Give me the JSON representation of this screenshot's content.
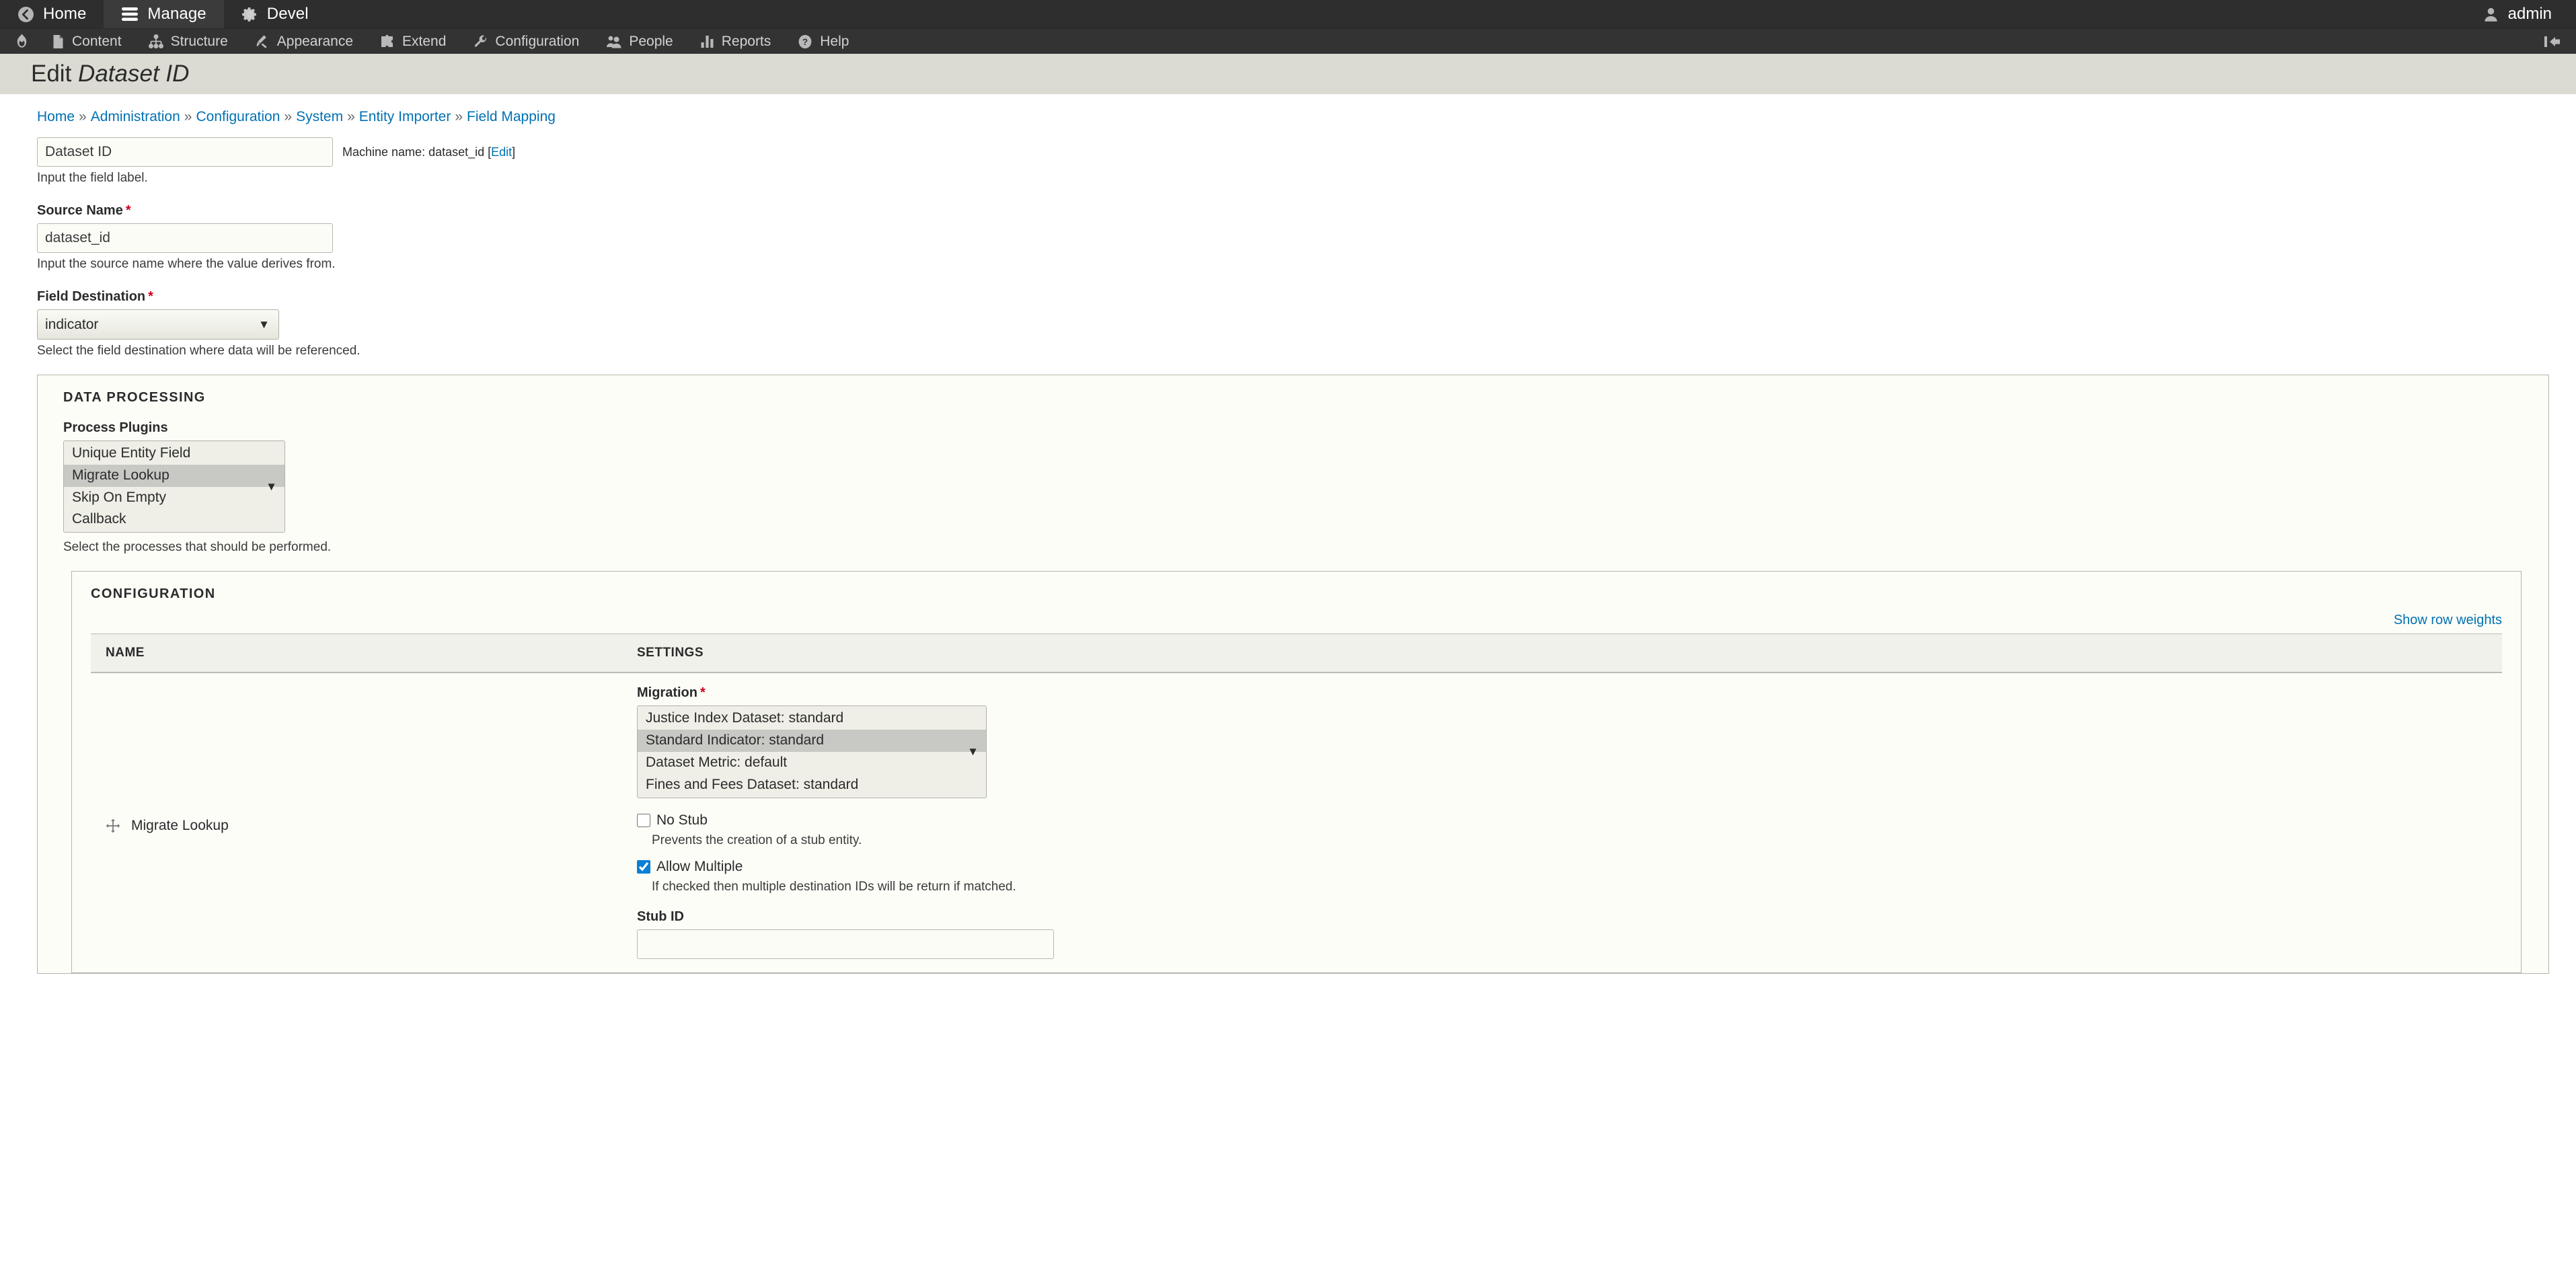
{
  "toolbar": {
    "items": [
      {
        "label": "Home",
        "icon": "home-back-icon",
        "active": false
      },
      {
        "label": "Manage",
        "icon": "hamburger-icon",
        "active": true
      },
      {
        "label": "Devel",
        "icon": "gear-icon",
        "active": false
      }
    ],
    "account": {
      "label": "admin",
      "icon": "user-avatar-icon"
    }
  },
  "admin_menu": {
    "home_icon": "drupal-drop-icon",
    "items": [
      {
        "label": "Content",
        "icon": "document-icon"
      },
      {
        "label": "Structure",
        "icon": "sitemap-icon"
      },
      {
        "label": "Appearance",
        "icon": "paintbrush-icon"
      },
      {
        "label": "Extend",
        "icon": "puzzle-piece-icon"
      },
      {
        "label": "Configuration",
        "icon": "wrench-icon"
      },
      {
        "label": "People",
        "icon": "people-icon"
      },
      {
        "label": "Reports",
        "icon": "bar-chart-icon"
      },
      {
        "label": "Help",
        "icon": "question-mark-icon"
      }
    ],
    "collapse_icon": "collapse-sidebar-icon"
  },
  "page": {
    "title_prefix": "Edit",
    "title_emphasis": "Dataset ID"
  },
  "breadcrumb": {
    "separator": "»",
    "items": [
      "Home",
      "Administration",
      "Configuration",
      "System",
      "Entity Importer",
      "Field Mapping"
    ]
  },
  "form": {
    "label_field": {
      "value": "Dataset ID",
      "machine_name_prefix": "Machine name: dataset_id [",
      "machine_name_edit": "Edit",
      "machine_name_suffix": "]",
      "description": "Input the field label."
    },
    "source_name": {
      "label": "Source Name",
      "required_mark": "*",
      "value": "dataset_id",
      "description": "Input the source name where the value derives from."
    },
    "field_destination": {
      "label": "Field Destination",
      "required_mark": "*",
      "selected": "indicator",
      "options": [
        "indicator"
      ],
      "description": "Select the field destination where data will be referenced."
    }
  },
  "data_processing": {
    "title": "Data Processing",
    "process_plugins": {
      "label": "Process Plugins",
      "options": [
        {
          "label": "Unique Entity Field",
          "selected": false
        },
        {
          "label": "Migrate Lookup",
          "selected": true
        },
        {
          "label": "Skip On Empty",
          "selected": false
        },
        {
          "label": "Callback",
          "selected": false
        }
      ],
      "description": "Select the processes that should be performed."
    },
    "configuration": {
      "title": "Configuration",
      "show_row_weights": "Show row weights",
      "columns": [
        "Name",
        "Settings"
      ],
      "rows": [
        {
          "name": "Migrate Lookup",
          "drag_icon": "drag-handle-icon",
          "settings": {
            "migration": {
              "label": "Migration",
              "required_mark": "*",
              "options": [
                {
                  "label": "Justice Index Dataset: standard",
                  "selected": false
                },
                {
                  "label": "Standard Indicator: standard",
                  "selected": true
                },
                {
                  "label": "Dataset Metric: default",
                  "selected": false
                },
                {
                  "label": "Fines and Fees Dataset: standard",
                  "selected": false
                }
              ]
            },
            "no_stub": {
              "label": "No Stub",
              "checked": false,
              "description": "Prevents the creation of a stub entity."
            },
            "allow_multiple": {
              "label": "Allow Multiple",
              "checked": true,
              "description": "If checked then multiple destination IDs will be return if matched."
            },
            "stub_id": {
              "label": "Stub ID",
              "value": ""
            }
          }
        }
      ]
    }
  },
  "colors": {
    "toolbar_bg": "#2e2e2e",
    "admin_bar_bg": "#333333",
    "title_band_bg": "#dbdbd3",
    "link_blue": "#0071b3",
    "required_red": "#d0021b",
    "fieldset_bg": "#fcfdf7",
    "checkbox_accent": "#0a7fd6",
    "selected_option_bg": "#c8c8c4"
  }
}
